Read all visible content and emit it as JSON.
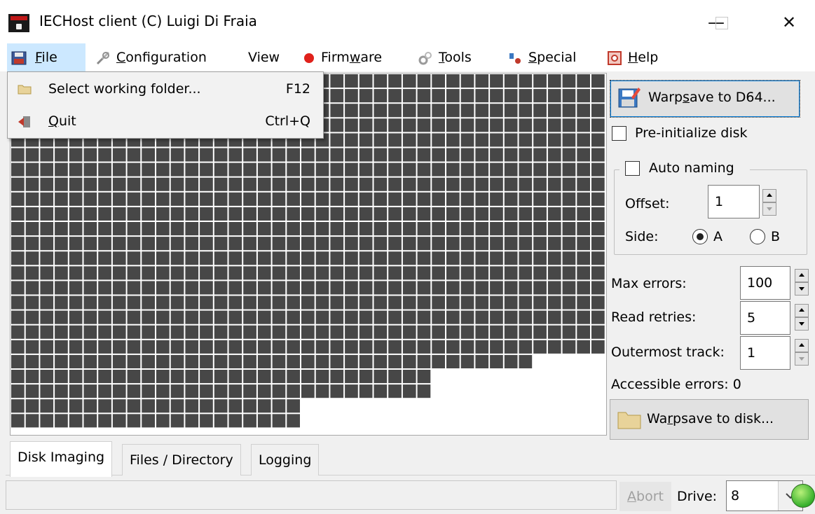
{
  "window": {
    "title": "IECHost client (C) Luigi Di Fraia",
    "minimize_glyph": "—",
    "close_glyph": "✕"
  },
  "menu": {
    "file": {
      "pre": "",
      "u": "F",
      "post": "ile",
      "icon": "floppy-icon"
    },
    "configuration": {
      "pre": "",
      "u": "C",
      "post": "onfiguration",
      "icon": "wrench-icon"
    },
    "view": {
      "label": "View"
    },
    "firmware": {
      "pre": "Firm",
      "u": "w",
      "post": "are",
      "icon": "red-dot-icon"
    },
    "tools": {
      "pre": "",
      "u": "T",
      "post": "ools",
      "icon": "gears-icon"
    },
    "special": {
      "pre": "",
      "u": "S",
      "post": "pecial",
      "icon": "magic-icon"
    },
    "help": {
      "pre": "",
      "u": "H",
      "post": "elp",
      "icon": "lifebuoy-icon"
    }
  },
  "file_menu": {
    "items": [
      {
        "label": "Select working folder...",
        "shortcut": "F12",
        "icon": "folder-icon"
      },
      {
        "pre": "",
        "u": "Q",
        "post": "uit",
        "shortcut": "Ctrl+Q",
        "icon": "exit-door-icon"
      }
    ]
  },
  "grid": {
    "cell_color": "#474747",
    "line_color": "#ffffff",
    "columns": 41,
    "full_rows": 19,
    "row_lengths": [
      41,
      41,
      41,
      41,
      41,
      41,
      41,
      41,
      41,
      41,
      41,
      41,
      41,
      41,
      41,
      41,
      41,
      41,
      41,
      36,
      29,
      29,
      20,
      20
    ]
  },
  "side_panel": {
    "warpsave_d64": {
      "pre": "Warp",
      "u": "s",
      "post": "ave to D64...",
      "icon": "disk-save-icon"
    },
    "pre_initialize": {
      "label": "Pre-initialize disk",
      "checked": false
    },
    "auto_naming": {
      "label": "Auto naming",
      "checked": false
    },
    "offset": {
      "label": "Offset:",
      "value": "1"
    },
    "side": {
      "label": "Side:",
      "option_a": "A",
      "option_b": "B",
      "selected": "A"
    },
    "max_errors": {
      "label": "Max errors:",
      "value": "100"
    },
    "read_retries": {
      "label": "Read retries:",
      "value": "5"
    },
    "outermost_track": {
      "label": "Outermost track:",
      "value": "1"
    },
    "accessible_errors": {
      "label": "Accessible errors:",
      "value": "0"
    },
    "warpsave_disk": {
      "pre": "Wa",
      "u": "r",
      "post": "psave to disk...",
      "icon": "folder-icon"
    }
  },
  "tabs": [
    {
      "label": "Disk Imaging",
      "active": true
    },
    {
      "label": "Files / Directory",
      "active": false
    },
    {
      "label": "Logging",
      "active": false
    }
  ],
  "status": {
    "abort": {
      "pre": "",
      "u": "A",
      "post": "bort"
    },
    "drive_label": "Drive:",
    "drive_value": "8",
    "led_color": "#36b02c"
  }
}
